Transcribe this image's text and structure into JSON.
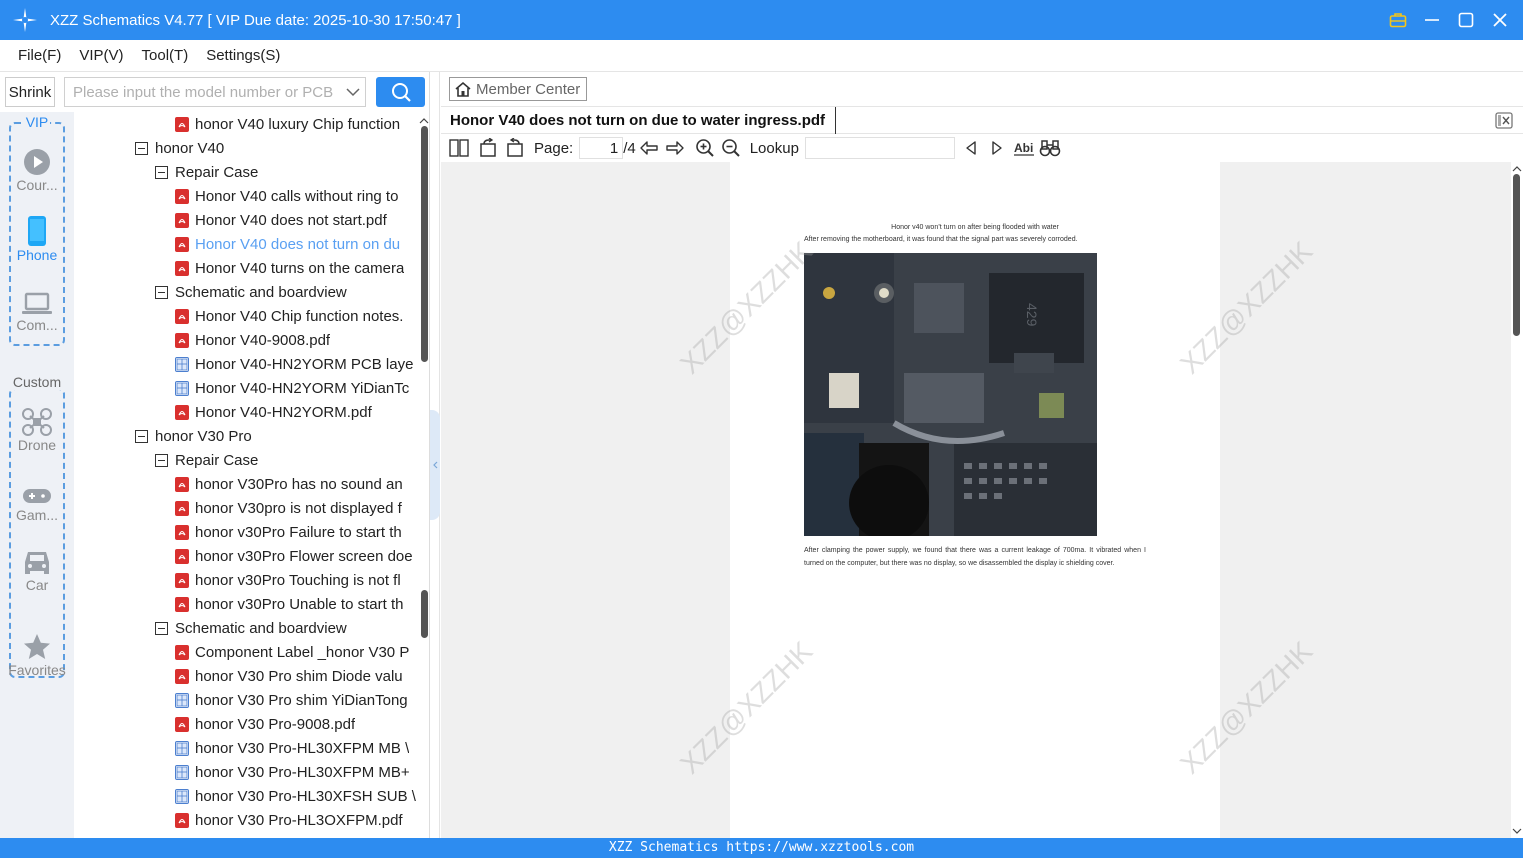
{
  "window": {
    "title": "XZZ Schematics V4.77 [ VIP Due date: 2025-10-30 17:50:47 ]"
  },
  "menu": [
    "File(F)",
    "VIP(V)",
    "Tool(T)",
    "Settings(S)"
  ],
  "left": {
    "shrink_label": "Shrink",
    "search_placeholder": "Please input the model number or PCB",
    "vip_label": "VIP",
    "custom_label": "Custom",
    "categories": [
      {
        "label": "Cour...",
        "icon": "play-circle-icon"
      },
      {
        "label": "Phone",
        "icon": "phone-icon"
      },
      {
        "label": "Com...",
        "icon": "laptop-icon"
      },
      {
        "label": "Drone",
        "icon": "drone-icon"
      },
      {
        "label": "Gam...",
        "icon": "gamepad-icon"
      },
      {
        "label": "Car",
        "icon": "car-icon"
      }
    ],
    "favorites_label": "Favorites",
    "tree": [
      {
        "level": 2,
        "type": "pdf",
        "label": "honor V40 luxury Chip function"
      },
      {
        "level": 0,
        "type": "folder",
        "label": "honor V40"
      },
      {
        "level": 1,
        "type": "folder",
        "label": "Repair Case"
      },
      {
        "level": 2,
        "type": "pdf",
        "label": "Honor V40 calls without ring to"
      },
      {
        "level": 2,
        "type": "pdf",
        "label": "Honor V40 does not start.pdf"
      },
      {
        "level": 2,
        "type": "pdf",
        "label": "Honor V40 does not turn on du",
        "selected": true
      },
      {
        "level": 2,
        "type": "pdf",
        "label": "Honor V40 turns on the camera"
      },
      {
        "level": 1,
        "type": "folder",
        "label": "Schematic and boardview"
      },
      {
        "level": 2,
        "type": "pdf",
        "label": "Honor V40 Chip function notes."
      },
      {
        "level": 2,
        "type": "pdf",
        "label": "Honor V40-9008.pdf"
      },
      {
        "level": 2,
        "type": "pcb",
        "label": "Honor V40-HN2YORM PCB laye"
      },
      {
        "level": 2,
        "type": "pcb",
        "label": "Honor V40-HN2YORM YiDianTc"
      },
      {
        "level": 2,
        "type": "pdf",
        "label": "Honor V40-HN2YORM.pdf"
      },
      {
        "level": 0,
        "type": "folder",
        "label": "honor V30 Pro"
      },
      {
        "level": 1,
        "type": "folder",
        "label": "Repair Case"
      },
      {
        "level": 2,
        "type": "pdf",
        "label": "honor V30Pro has no sound an"
      },
      {
        "level": 2,
        "type": "pdf",
        "label": "honor V30pro is not displayed f"
      },
      {
        "level": 2,
        "type": "pdf",
        "label": "honor v30Pro Failure to start th"
      },
      {
        "level": 2,
        "type": "pdf",
        "label": "honor v30Pro Flower screen doe"
      },
      {
        "level": 2,
        "type": "pdf",
        "label": "honor v30Pro Touching is not fl"
      },
      {
        "level": 2,
        "type": "pdf",
        "label": "honor v30Pro Unable to start th"
      },
      {
        "level": 1,
        "type": "folder",
        "label": "Schematic and boardview"
      },
      {
        "level": 2,
        "type": "pdf",
        "label": "Component Label _honor V30 P"
      },
      {
        "level": 2,
        "type": "pdf",
        "label": "honor V30 Pro shim Diode valu"
      },
      {
        "level": 2,
        "type": "pcb",
        "label": "honor V30 Pro shim YiDianTong"
      },
      {
        "level": 2,
        "type": "pdf",
        "label": "honor V30 Pro-9008.pdf"
      },
      {
        "level": 2,
        "type": "pcb",
        "label": "honor V30 Pro-HL30XFPM MB \\"
      },
      {
        "level": 2,
        "type": "pcb",
        "label": "honor V30 Pro-HL30XFPM MB+"
      },
      {
        "level": 2,
        "type": "pcb",
        "label": "honor V30 Pro-HL30XFSH SUB \\"
      },
      {
        "level": 2,
        "type": "pdf",
        "label": "honor V30 Pro-HL3OXFPM.pdf"
      }
    ]
  },
  "right": {
    "member_center": "Member Center",
    "doc_tab": "Honor V40 does not turn on due to water ingress.pdf",
    "toolbar": {
      "page_label": "Page:",
      "page_value": "1",
      "page_total": "/4",
      "lookup_label": "Lookup"
    },
    "document": {
      "title": "Honor v40 won’t turn on after being flooded with water",
      "line1": "After removing the motherboard, it was found that the signal part was severely corroded.",
      "para": "After clamping the power supply, we found that there was a current leakage of 700ma. It vibrated when I turned on the computer, but there was no display, so we disassembled the display ic shielding cover.",
      "watermark": "XZZ@XZZHK"
    }
  },
  "status": {
    "text": "XZZ Schematics https://www.xzztools.com"
  },
  "colors": {
    "accent": "#2d8cf0",
    "pdf_icon": "#d9302e",
    "selected_text": "#5aa0f2"
  }
}
